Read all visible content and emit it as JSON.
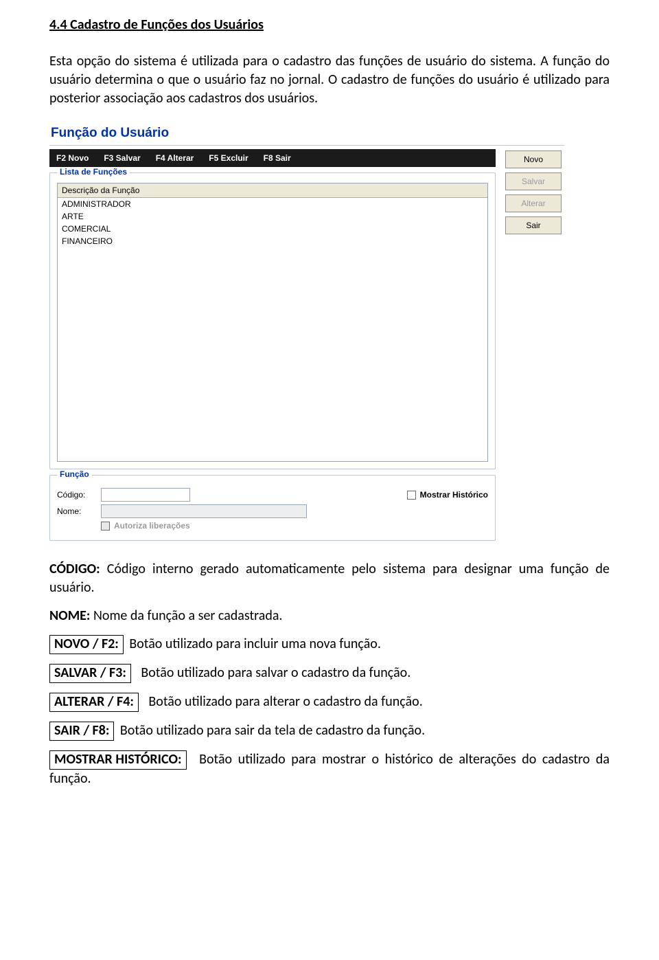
{
  "doc": {
    "section_title": "4.4 Cadastro de Funções dos Usuários",
    "intro": "Esta opção do sistema é utilizada para o cadastro das funções de usuário do sistema. A função do usuário determina o que o usuário faz no jornal. O cadastro de funções do usuário é utilizado para posterior associação aos cadastros dos usuários."
  },
  "app": {
    "title": "Função do Usuário",
    "toolbar": {
      "f2": "F2 Novo",
      "f3": "F3 Salvar",
      "f4": "F4 Alterar",
      "f5": "F5 Excluir",
      "f8": "F8 Sair"
    },
    "buttons": {
      "novo": "Novo",
      "salvar": "Salvar",
      "alterar": "Alterar",
      "sair": "Sair"
    },
    "list": {
      "legend": "Lista de Funções",
      "header": "Descrição da Função",
      "rows": [
        "ADMINISTRADOR",
        "ARTE",
        "COMERCIAL",
        "FINANCEIRO"
      ]
    },
    "funcao": {
      "legend": "Função",
      "codigo_label": "Código:",
      "nome_label": "Nome:",
      "codigo_value": "",
      "nome_value": "",
      "mostrar_hist": "Mostrar Histórico",
      "autoriza": "Autoriza liberações"
    }
  },
  "desc": {
    "codigo_label": "CÓDIGO:",
    "codigo_text": "Código interno gerado automaticamente pelo sistema para designar uma função de usuário.",
    "nome_label": "NOME:",
    "nome_text": "Nome da função a ser cadastrada.",
    "novo_box": "NOVO / F2:",
    "novo_text": "Botão utilizado para incluir uma nova função.",
    "salvar_box": "SALVAR / F3:",
    "salvar_text": "Botão utilizado para salvar o cadastro da função.",
    "alterar_box": "ALTERAR / F4:",
    "alterar_text": "Botão utilizado para alterar o cadastro da função.",
    "sair_box": "SAIR / F8:",
    "sair_text": "Botão utilizado para sair da tela de cadastro da função.",
    "mostrar_box": "MOSTRAR HISTÓRICO:",
    "mostrar_text": "Botão utilizado para mostrar o histórico de alterações do cadastro da função."
  }
}
